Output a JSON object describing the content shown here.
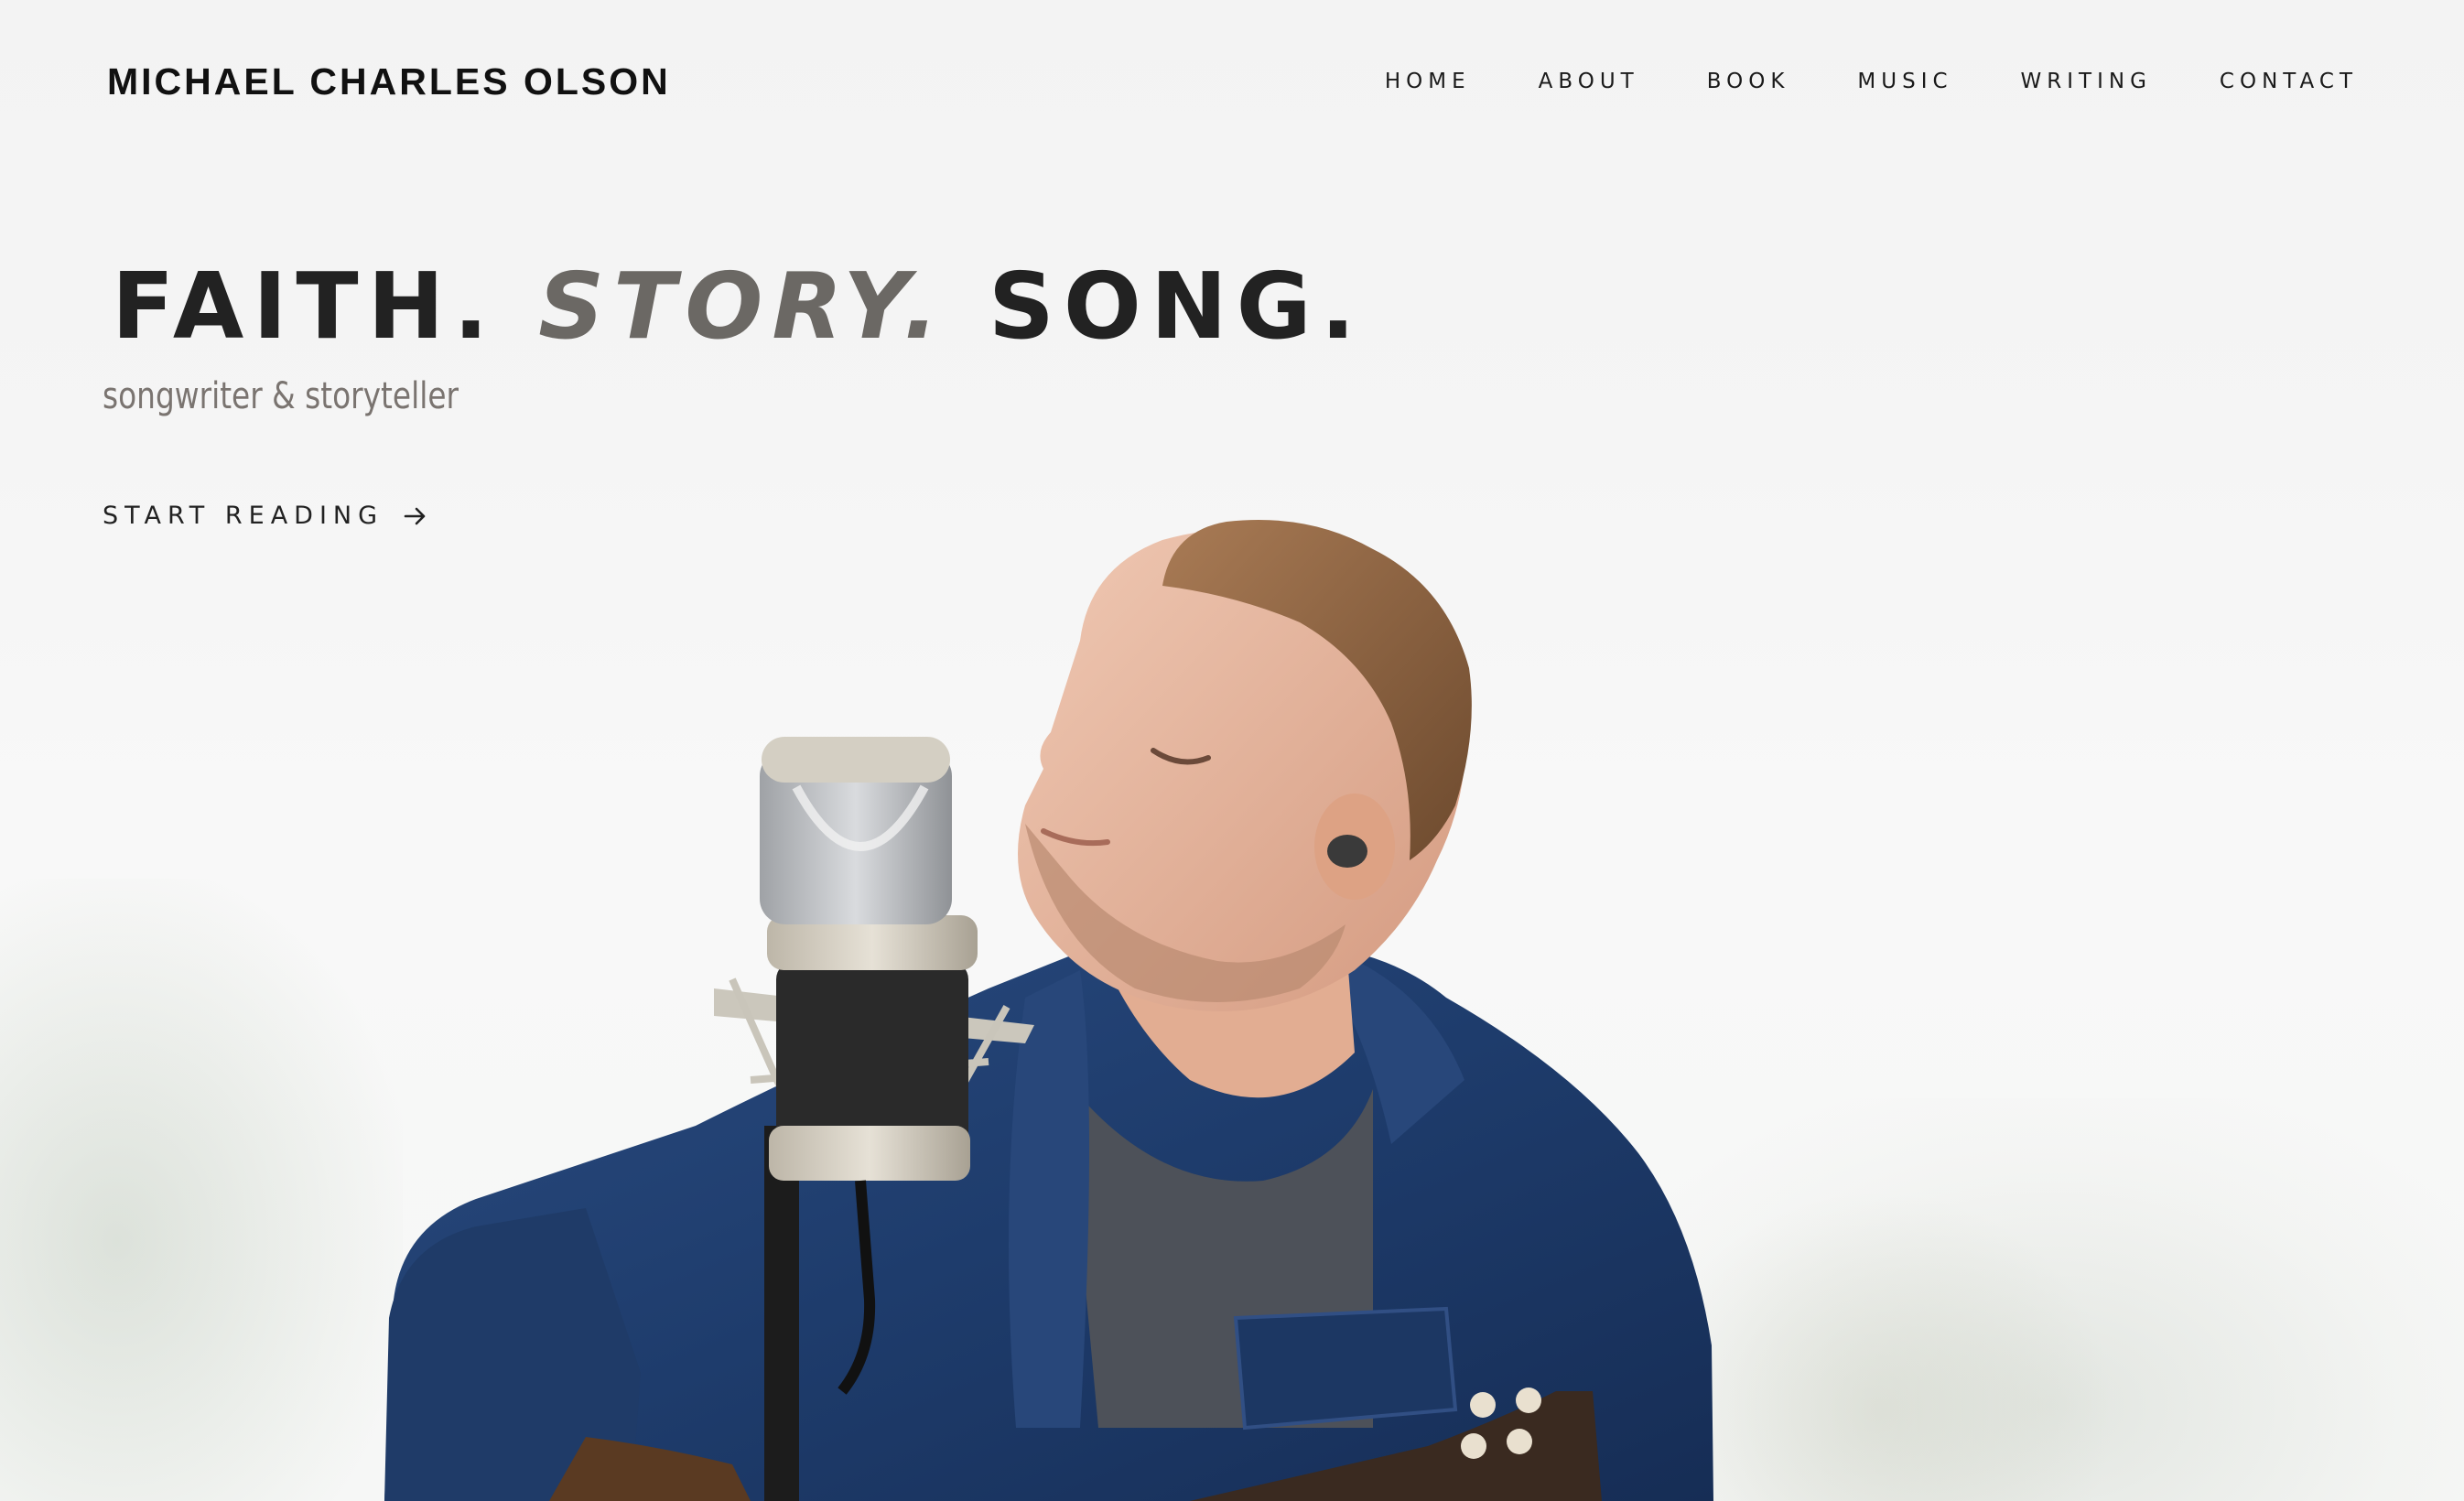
{
  "header": {
    "site_title": "MICHAEL CHARLES OLSON",
    "nav": [
      "HOME",
      "ABOUT",
      "BOOK",
      "MUSIC",
      "WRITING",
      "CONTACT"
    ]
  },
  "hero": {
    "headline_part1": "FAITH.",
    "headline_part2": "STORY.",
    "headline_part3": "SONG.",
    "tagline": "songwriter & storyteller",
    "cta_label": "START READING",
    "cta_icon": "arrow-right-icon",
    "image_subject": "hero-photo"
  },
  "colors": {
    "background": "#f4f4f4",
    "headline": "#222222",
    "headline_accent": "#6b6864",
    "tagline": "#7a7470",
    "jacket": "#1f3d6e"
  }
}
